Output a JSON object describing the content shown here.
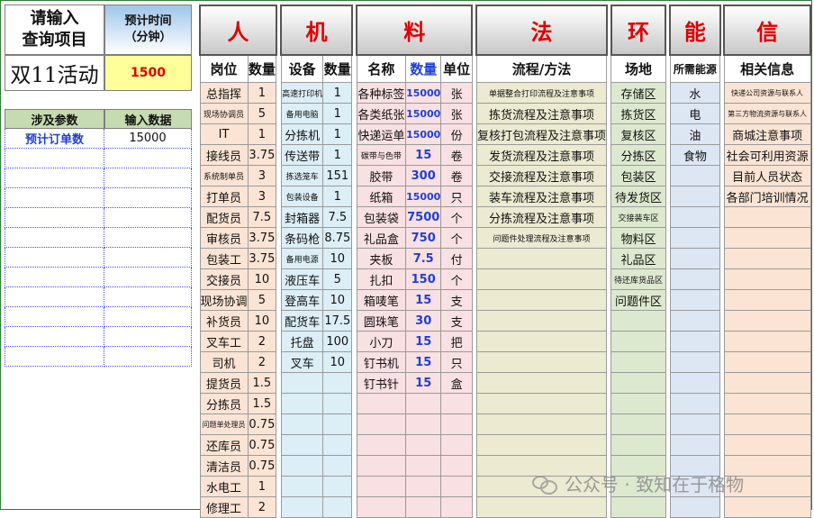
{
  "left": {
    "query_label": "请输入\n查询项目",
    "time_label": "预计时间\n（分钟）",
    "project_name": "双11活动",
    "project_time": "1500",
    "param_headers": [
      "涉及参数",
      "输入数据"
    ],
    "params": [
      {
        "name": "预计订单数",
        "value": "15000"
      },
      {
        "name": "",
        "value": ""
      },
      {
        "name": "",
        "value": ""
      },
      {
        "name": "",
        "value": ""
      },
      {
        "name": "",
        "value": ""
      },
      {
        "name": "",
        "value": ""
      },
      {
        "name": "",
        "value": ""
      },
      {
        "name": "",
        "value": ""
      },
      {
        "name": "",
        "value": ""
      },
      {
        "name": "",
        "value": ""
      },
      {
        "name": "",
        "value": ""
      },
      {
        "name": "",
        "value": ""
      }
    ]
  },
  "big_headers": [
    "人",
    "机",
    "料",
    "法",
    "环",
    "能",
    "信"
  ],
  "sub_headers": [
    "岗位",
    "数量",
    "设备",
    "数量",
    "名称",
    "数量",
    "单位",
    "流程/方法",
    "场地",
    "所需能源",
    "相关信息"
  ],
  "rows": [
    [
      "总指挥",
      "1",
      "高速打印机",
      "1",
      "各种标签",
      "15000",
      "张",
      "单据整合打印流程及注意事项",
      "存储区",
      "水",
      "快递公司资源与联系人"
    ],
    [
      "现场协调员",
      "5",
      "备用电脑",
      "1",
      "各类纸张",
      "15000",
      "张",
      "拣货流程及注意事项",
      "拣货区",
      "电",
      "第三方物流资源与联系人"
    ],
    [
      "IT",
      "1",
      "分拣机",
      "1",
      "快递运单",
      "15000",
      "份",
      "复核打包流程及注意事项",
      "复核区",
      "油",
      "商城注意事项"
    ],
    [
      "接线员",
      "3.75",
      "传送带",
      "1",
      "碳带与色带",
      "15",
      "卷",
      "发货流程及注意事项",
      "分拣区",
      "食物",
      "社会可利用资源"
    ],
    [
      "系统制单员",
      "3",
      "拣选笼车",
      "151",
      "胶带",
      "300",
      "卷",
      "交接流程及注意事项",
      "包装区",
      "",
      "目前人员状态"
    ],
    [
      "打单员",
      "3",
      "包装设备",
      "1",
      "纸箱",
      "15000",
      "只",
      "装车流程及注意事项",
      "待发货区",
      "",
      "各部门培训情况"
    ],
    [
      "配货员",
      "7.5",
      "封箱器",
      "7.5",
      "包装袋",
      "7500",
      "个",
      "分拣流程及注意事项",
      "交接装车区",
      "",
      ""
    ],
    [
      "审核员",
      "3.75",
      "条码枪",
      "8.75",
      "礼品盒",
      "750",
      "个",
      "问题件处理流程及注意事项",
      "物料区",
      "",
      ""
    ],
    [
      "包装工",
      "3.75",
      "备用电源",
      "10",
      "夹板",
      "7.5",
      "付",
      "",
      "礼品区",
      "",
      ""
    ],
    [
      "交接员",
      "10",
      "液压车",
      "5",
      "扎扣",
      "150",
      "个",
      "",
      "待还库货品区",
      "",
      ""
    ],
    [
      "现场协调",
      "5",
      "登高车",
      "10",
      "箱唛笔",
      "15",
      "支",
      "",
      "问题件区",
      "",
      ""
    ],
    [
      "补货员",
      "10",
      "配货车",
      "17.5",
      "圆珠笔",
      "30",
      "支",
      "",
      "",
      "",
      ""
    ],
    [
      "叉车工",
      "2",
      "托盘",
      "100",
      "小刀",
      "15",
      "把",
      "",
      "",
      "",
      ""
    ],
    [
      "司机",
      "2",
      "叉车",
      "10",
      "钉书机",
      "15",
      "只",
      "",
      "",
      "",
      ""
    ],
    [
      "提货员",
      "1.5",
      "",
      "",
      "钉书针",
      "15",
      "盒",
      "",
      "",
      "",
      ""
    ],
    [
      "分拣员",
      "1.5",
      "",
      "",
      "",
      "",
      "",
      "",
      "",
      "",
      ""
    ],
    [
      "问题单处理员",
      "0.75",
      "",
      "",
      "",
      "",
      "",
      "",
      "",
      "",
      ""
    ],
    [
      "还库员",
      "0.75",
      "",
      "",
      "",
      "",
      "",
      "",
      "",
      "",
      ""
    ],
    [
      "清洁员",
      "0.75",
      "",
      "",
      "",
      "",
      "",
      "",
      "",
      "",
      ""
    ],
    [
      "水电工",
      "1",
      "",
      "",
      "",
      "",
      "",
      "",
      "",
      "",
      ""
    ],
    [
      "修理工",
      "2",
      "",
      "",
      "",
      "",
      "",
      "",
      "",
      "",
      ""
    ]
  ],
  "watermark": "公众号 · 致知在于格物"
}
